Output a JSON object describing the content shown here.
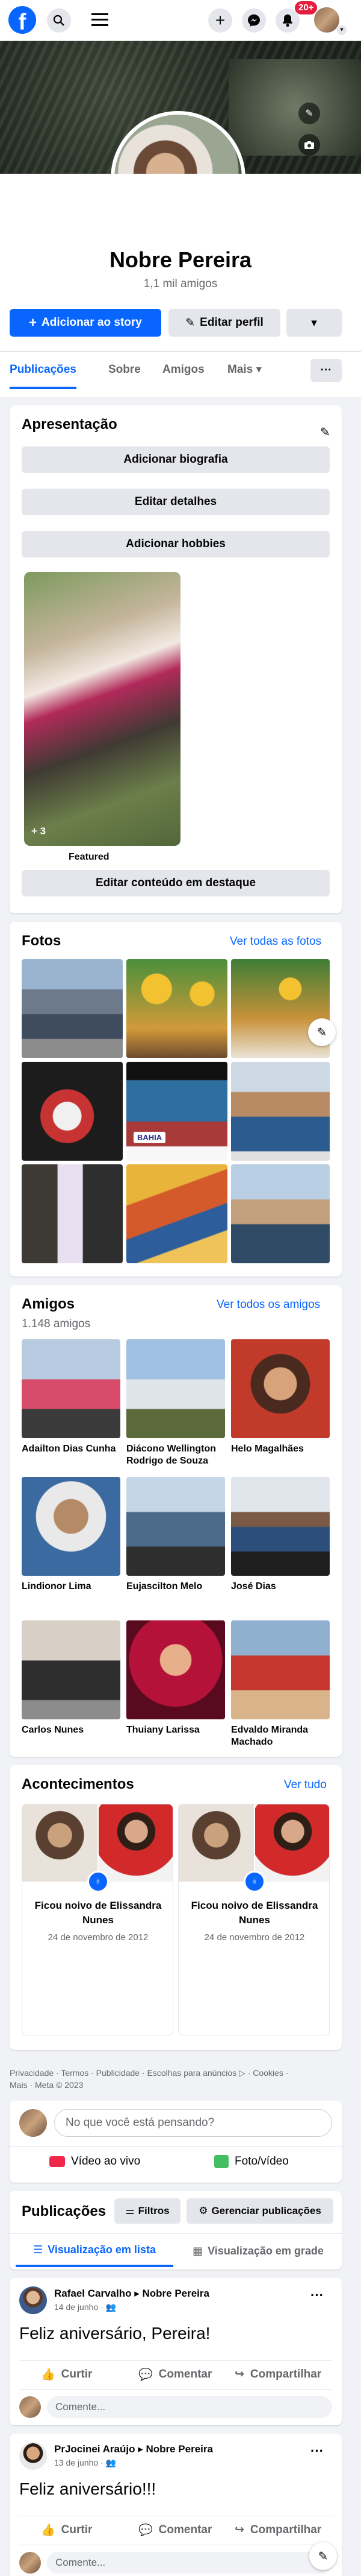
{
  "topbar": {
    "logo": "f",
    "notif_badge": "20+",
    "icons": [
      "search-icon",
      "menu-icon",
      "plus-icon",
      "messenger-icon",
      "bell-icon"
    ]
  },
  "profile": {
    "name": "Nobre Pereira",
    "friends_count": "1,1 mil amigos",
    "add_story": "Adicionar ao story",
    "edit_profile": "Editar perfil"
  },
  "tabs": [
    {
      "label": "Publicações",
      "active": true
    },
    {
      "label": "Sobre"
    },
    {
      "label": "Amigos"
    },
    {
      "label": "Mais"
    }
  ],
  "intro": {
    "title": "Apresentação",
    "add_bio": "Adicionar biografia",
    "edit_details": "Editar detalhes",
    "add_hobbies": "Adicionar hobbies",
    "featured_count": "+ 3",
    "featured_label": "Featured",
    "edit_featured": "Editar conteúdo em destaque"
  },
  "photos": {
    "title": "Fotos",
    "see_all": "Ver todas as fotos",
    "badge_text": "BAHIA"
  },
  "friends": {
    "title": "Amigos",
    "see_all": "Ver todos os amigos",
    "count": "1.148 amigos",
    "list": [
      {
        "name": "Adailton Dias Cunha"
      },
      {
        "name": "Diácono Wellington Rodrigo de Souza"
      },
      {
        "name": "Helo Magalhães"
      },
      {
        "name": "Lindionor Lima"
      },
      {
        "name": "Eujascilton Melo"
      },
      {
        "name": "José Dias"
      },
      {
        "name": "Carlos Nunes"
      },
      {
        "name": "Thuiany Larissa"
      },
      {
        "name": "Edvaldo Miranda Machado"
      }
    ]
  },
  "events": {
    "title": "Acontecimentos",
    "see_all": "Ver tudo",
    "items": [
      {
        "title": "Ficou noivo de Elissandra Nunes",
        "date": "24 de novembro de 2012"
      },
      {
        "title": "Ficou noivo de Elissandra Nunes",
        "date": "24 de novembro de 2012"
      }
    ]
  },
  "footer": {
    "line1": "Privacidade · Termos · Publicidade · Escolhas para anúncios ▷ · Cookies ·",
    "line2": "Mais · Meta © 2023"
  },
  "composer": {
    "placeholder": "No que você está pensando?",
    "live": "Vídeo ao vivo",
    "photo": "Foto/vídeo"
  },
  "posts_header": {
    "title": "Publicações",
    "filters": "Filtros",
    "manage": "Gerenciar publicações",
    "list_view": "Visualização em lista",
    "grid_view": "Visualização em grade"
  },
  "posts": [
    {
      "author": "Rafael Carvalho ▸ Nobre Pereira",
      "date": "14 de junho ·",
      "text": "Feliz aniversário, Pereira!"
    },
    {
      "author": "PrJocinei Araújo ▸ Nobre Pereira",
      "date": "13 de junho ·",
      "text": "Feliz aniversário!!!"
    }
  ],
  "post_actions": {
    "like": "Curtir",
    "comment": "Comentar",
    "share": "Compartilhar",
    "comment_placeholder": "Comente..."
  },
  "colors": {
    "accent": "#0866ff",
    "badge": "#e41e3f",
    "bg": "#f0f2f5"
  }
}
